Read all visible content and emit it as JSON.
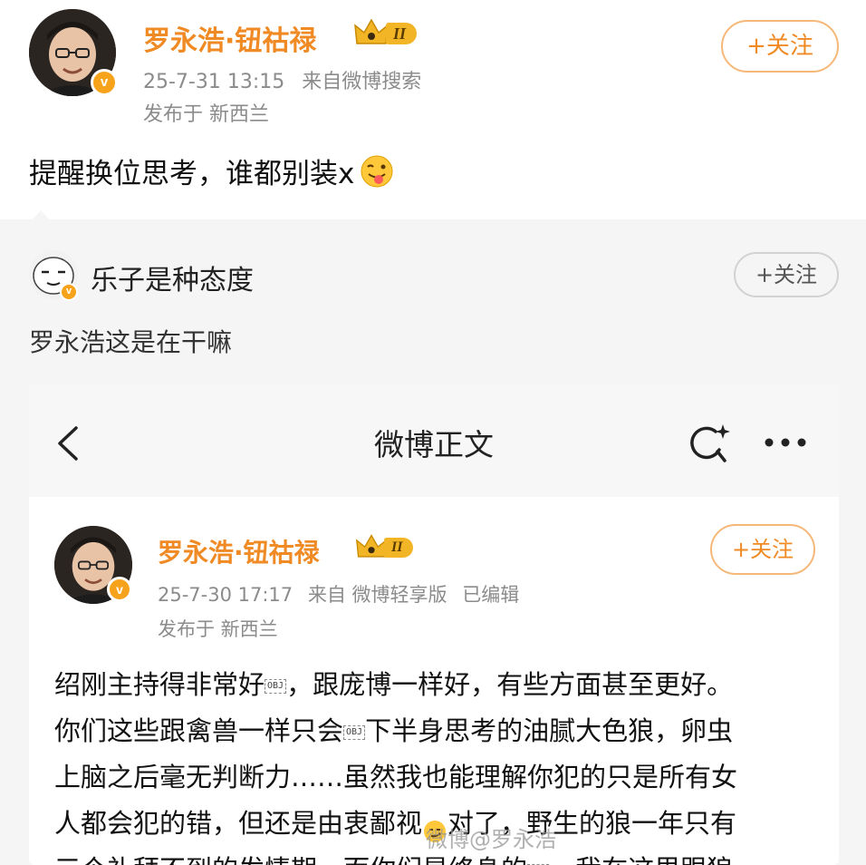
{
  "main_post": {
    "author": "罗永浩·钮祜禄",
    "rank_badge": "II",
    "timestamp": "25-7-31 13:15",
    "source": "来自微博搜索",
    "location": "发布于 新西兰",
    "follow_label": "+关注",
    "text": "提醒换位思考，谁都别装x",
    "emoji": "tongue-wink-emoji"
  },
  "comment": {
    "username": "乐子是种态度",
    "follow_label": "+关注",
    "text": "罗永浩这是在干嘛"
  },
  "embedded": {
    "nav_title": "微博正文",
    "back_icon": "back-arrow-icon",
    "search_icon": "sparkle-search-icon",
    "more_icon": "more-dots-icon",
    "author": "罗永浩·钮祜禄",
    "rank_badge": "II",
    "timestamp": "25-7-30 17:17",
    "source": "来自 微博轻享版",
    "edited": "已编辑",
    "location": "发布于 新西兰",
    "follow_label": "+关注",
    "obj_label": "OBJ",
    "body": {
      "line1a": "绍刚主持得非常好",
      "line1b": "，跟庞博一样好，有些方面甚至更好。",
      "line2a": "你们这些跟禽兽一样只会",
      "line2b": "下半身思考的油腻大色狼，卵虫",
      "line3": "上脑之后毫无判断力……虽然我也能理解你犯的只是所有女",
      "line4a": "人都会犯的错，但还是由衷鄙视",
      "line4b": "对了，野生的狼一年只有",
      "line5a": "三个礼拜不到的发情期，而你们是终身的",
      "line5b": "。我在这里跟狼"
    }
  },
  "watermark": "微博@罗永浩",
  "colors": {
    "orange": "#f08a24",
    "gray_text": "#8b8b8b",
    "badge_gold": "#f7a21b",
    "background_gray": "#f5f5f5"
  }
}
